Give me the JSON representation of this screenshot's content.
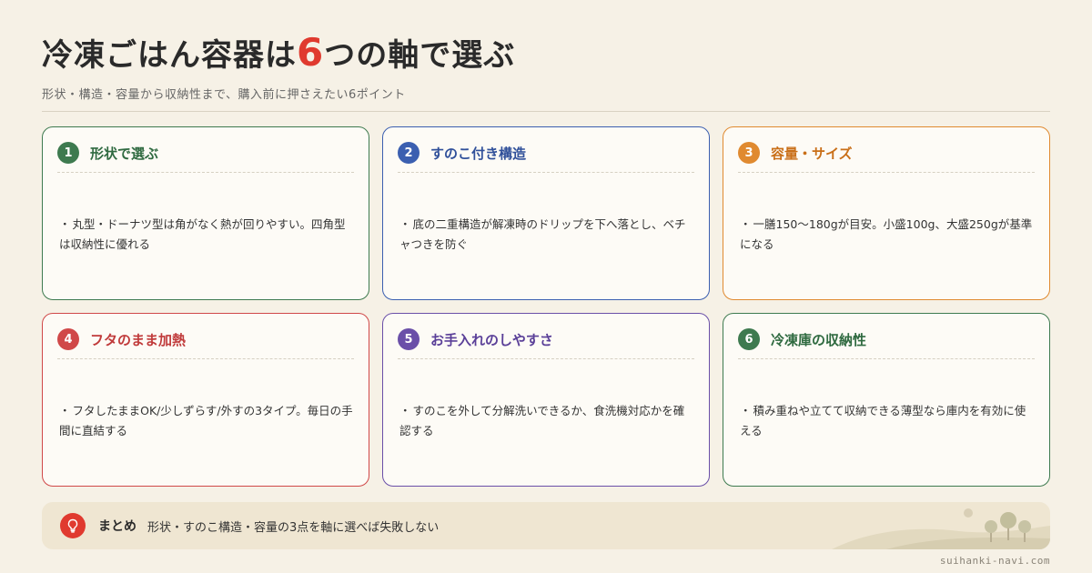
{
  "title": {
    "before": "冷凍ごはん容器は",
    "number": "6",
    "after": "つの軸で選ぶ"
  },
  "subtitle": "形状・構造・容量から収納性まで、購入前に押さえたい6ポイント",
  "cards": [
    {
      "num": "1",
      "title": "形状で選ぶ",
      "body": "丸型・ドーナツ型は角がなく熱が回りやすい。四角型は収納性に優れる",
      "color": "#3e7a4f"
    },
    {
      "num": "2",
      "title": "すのこ付き構造",
      "body": "底の二重構造が解凍時のドリップを下へ落とし、ベチャつきを防ぐ",
      "color": "#3b5fb0"
    },
    {
      "num": "3",
      "title": "容量・サイズ",
      "body": "一膳150〜180gが目安。小盛100g、大盛250gが基準になる",
      "color": "#e08a30"
    },
    {
      "num": "4",
      "title": "フタのまま加熱",
      "body": "フタしたままOK/少しずらす/外すの3タイプ。毎日の手間に直結する",
      "color": "#d04848"
    },
    {
      "num": "5",
      "title": "お手入れのしやすさ",
      "body": "すのこを外して分解洗いできるか、食洗機対応かを確認する",
      "color": "#6a4fa8"
    },
    {
      "num": "6",
      "title": "冷凍庫の収納性",
      "body": "積み重ねや立てて収納できる薄型なら庫内を有効に使える",
      "color": "#3e7a4f"
    }
  ],
  "summary": {
    "icon": "lightbulb-icon",
    "label": "まとめ",
    "text": "形状・すのこ構造・容量の3点を軸に選べば失敗しない"
  },
  "footer": "suihanki-navi.com",
  "colors": {
    "accent": "#e03a2f",
    "background": "#f6f1e6"
  }
}
